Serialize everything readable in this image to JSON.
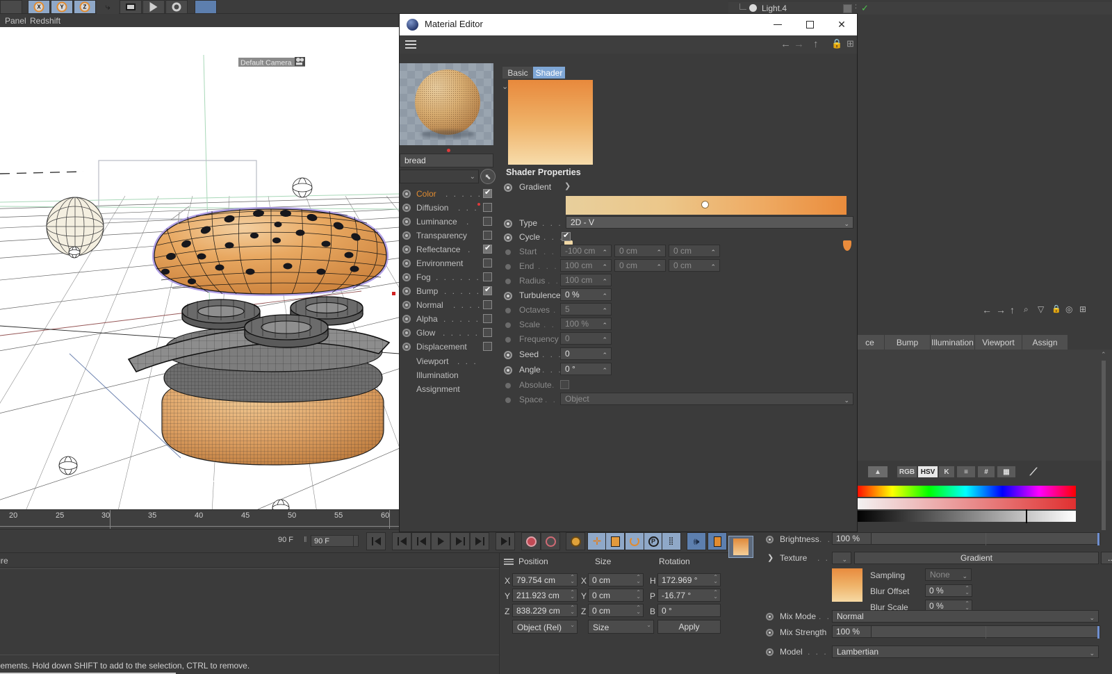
{
  "app": {
    "menu": [
      "Panel",
      "Redshift"
    ],
    "status_text": "elements. Hold down SHIFT to add to the selection, CTRL to remove.",
    "bottom_tab": "ture"
  },
  "viewport": {
    "camera_label": "Default Camera",
    "timeline_ticks": [
      "20",
      "25",
      "30",
      "35",
      "40",
      "45",
      "50",
      "55",
      "60"
    ]
  },
  "transport": {
    "current_frame": "90 F",
    "end_frame": "90 F"
  },
  "object_manager": {
    "item_label": "Light.4"
  },
  "material_editor": {
    "title": "Material Editor",
    "window_buttons": {
      "minimize": "–",
      "maximize": "□",
      "close": "✕"
    },
    "nav_icons": [
      "back-arrow",
      "forward-arrow",
      "up-arrow",
      "lock",
      "add"
    ],
    "material_name": "bread",
    "link_field_value": "",
    "tabs": [
      {
        "label": "Basic",
        "active": false
      },
      {
        "label": "Shader",
        "active": true
      }
    ],
    "channels": [
      {
        "label": "Color",
        "dots": ". . . . . .",
        "checked": true,
        "active": true,
        "reddot": false
      },
      {
        "label": "Diffusion",
        "dots": ". . . .",
        "checked": false,
        "active": false,
        "reddot": true
      },
      {
        "label": "Luminance",
        "dots": ".",
        "checked": false,
        "active": false,
        "reddot": false
      },
      {
        "label": "Transparency",
        "dots": "",
        "checked": false,
        "active": false,
        "reddot": false
      },
      {
        "label": "Reflectance",
        "dots": ".",
        "checked": true,
        "active": false,
        "reddot": false
      },
      {
        "label": "Environment",
        "dots": "",
        "checked": false,
        "active": false,
        "reddot": false
      },
      {
        "label": "Fog",
        "dots": ". . . . . .",
        "checked": false,
        "active": false,
        "reddot": false
      },
      {
        "label": "Bump",
        "dots": ". . . . . .",
        "checked": true,
        "active": false,
        "reddot": false
      },
      {
        "label": "Normal",
        "dots": ". . . .",
        "checked": false,
        "active": false,
        "reddot": false
      },
      {
        "label": "Alpha",
        "dots": ". . . . . .",
        "checked": false,
        "active": false,
        "reddot": false
      },
      {
        "label": "Glow",
        "dots": ". . . . .",
        "checked": false,
        "active": false,
        "reddot": false
      },
      {
        "label": "Displacement",
        "dots": "",
        "checked": false,
        "active": false,
        "reddot": false
      }
    ],
    "channel_extras": [
      {
        "label": "Viewport",
        "dots": ". . ."
      },
      {
        "label": "Illumination",
        "dots": ""
      },
      {
        "label": "Assignment",
        "dots": ""
      }
    ],
    "shader_properties_title": "Shader Properties",
    "properties": [
      {
        "label": "Gradient",
        "dots": "",
        "enabled": true,
        "kind": "gradient"
      },
      {
        "label": "Type",
        "dots": ". . . . .",
        "enabled": true,
        "kind": "dropdown",
        "value": "2D - V"
      },
      {
        "label": "Cycle",
        "dots": ". . . .",
        "enabled": true,
        "kind": "checkbox",
        "value": true
      },
      {
        "label": "Start",
        "dots": ". . . . .",
        "enabled": false,
        "kind": "vector3",
        "values": [
          "-100 cm",
          "0 cm",
          "0 cm"
        ]
      },
      {
        "label": "End",
        "dots": ". . . . . .",
        "enabled": false,
        "kind": "vector3",
        "values": [
          "100 cm",
          "0 cm",
          "0 cm"
        ]
      },
      {
        "label": "Radius",
        "dots": ". . .",
        "enabled": false,
        "kind": "field",
        "value": "100 cm"
      },
      {
        "label": "Turbulence",
        "dots": "",
        "enabled": true,
        "kind": "field",
        "value": "0 %"
      },
      {
        "label": "Octaves",
        "dots": ". .",
        "enabled": false,
        "kind": "field",
        "value": "5"
      },
      {
        "label": "Scale",
        "dots": ". . . .",
        "enabled": false,
        "kind": "field",
        "value": "100 %"
      },
      {
        "label": "Frequency",
        "dots": "",
        "enabled": false,
        "kind": "field",
        "value": "0"
      },
      {
        "label": "Seed",
        "dots": ". . . .",
        "enabled": true,
        "kind": "field",
        "value": "0"
      },
      {
        "label": "Angle",
        "dots": ". . . .",
        "enabled": true,
        "kind": "field",
        "value": "0 °"
      },
      {
        "label": "Absolute",
        "dots": ". .",
        "enabled": false,
        "kind": "checkbox",
        "value": false
      },
      {
        "label": "Space",
        "dots": ". . . .",
        "enabled": false,
        "kind": "dropdown",
        "value": "Object"
      }
    ],
    "gradient": {
      "stops": [
        "#f2d9a6",
        "#ea8c3c"
      ],
      "knob_position_pct": 49
    }
  },
  "coordinates": {
    "headers": [
      "Position",
      "Size",
      "Rotation"
    ],
    "rows": [
      {
        "axis_a": "X",
        "pos": "79.754 cm",
        "axis_b": "X",
        "size": "0 cm",
        "axis_c": "H",
        "rot": "172.969 °"
      },
      {
        "axis_a": "Y",
        "pos": "211.923 cm",
        "axis_b": "Y",
        "size": "0 cm",
        "axis_c": "P",
        "rot": "-16.77 °"
      },
      {
        "axis_a": "Z",
        "pos": "838.229 cm",
        "axis_b": "Z",
        "size": "0 cm",
        "axis_c": "B",
        "rot": "0 °"
      }
    ],
    "mode_left": "Object (Rel)",
    "mode_right": "Size",
    "apply_label": "Apply"
  },
  "attribute_manager": {
    "tabs": [
      "ce",
      "Bump",
      "Illumination",
      "Viewport",
      "Assign"
    ],
    "color_modes": [
      {
        "label": "RGB",
        "active": false
      },
      {
        "label": "HSV",
        "active": true
      },
      {
        "label": "K",
        "active": false
      },
      {
        "label": "slider-icon",
        "active": false
      },
      {
        "label": "#",
        "active": false
      },
      {
        "label": "grid-icon",
        "active": false
      }
    ],
    "rows": [
      {
        "label": "Brightness",
        "dots": ". .",
        "kind": "slider",
        "value": "100 %"
      },
      {
        "label": "Texture",
        "dots": ". . . .",
        "kind": "texture",
        "value": "Gradient",
        "more": "..."
      },
      {
        "label": "Mix Mode",
        "dots": ". .",
        "kind": "dropdown",
        "value": "Normal"
      },
      {
        "label": "Mix Strength",
        "dots": "",
        "kind": "slider",
        "value": "100 %"
      },
      {
        "label": "Model",
        "dots": ". . . .",
        "kind": "dropdown",
        "value": "Lambertian"
      }
    ],
    "texture_sub": [
      {
        "label": "Sampling",
        "value": "None",
        "kind": "dropdown"
      },
      {
        "label": "Blur Offset",
        "value": "0 %",
        "kind": "field"
      },
      {
        "label": "Blur Scale",
        "value": "0 %",
        "kind": "field"
      }
    ]
  },
  "colors": {
    "accent_blue": "#7fa7d6",
    "orange": "#e08b30",
    "panel_bg": "#3b3b3b",
    "field_bg": "#4b4b4b"
  }
}
